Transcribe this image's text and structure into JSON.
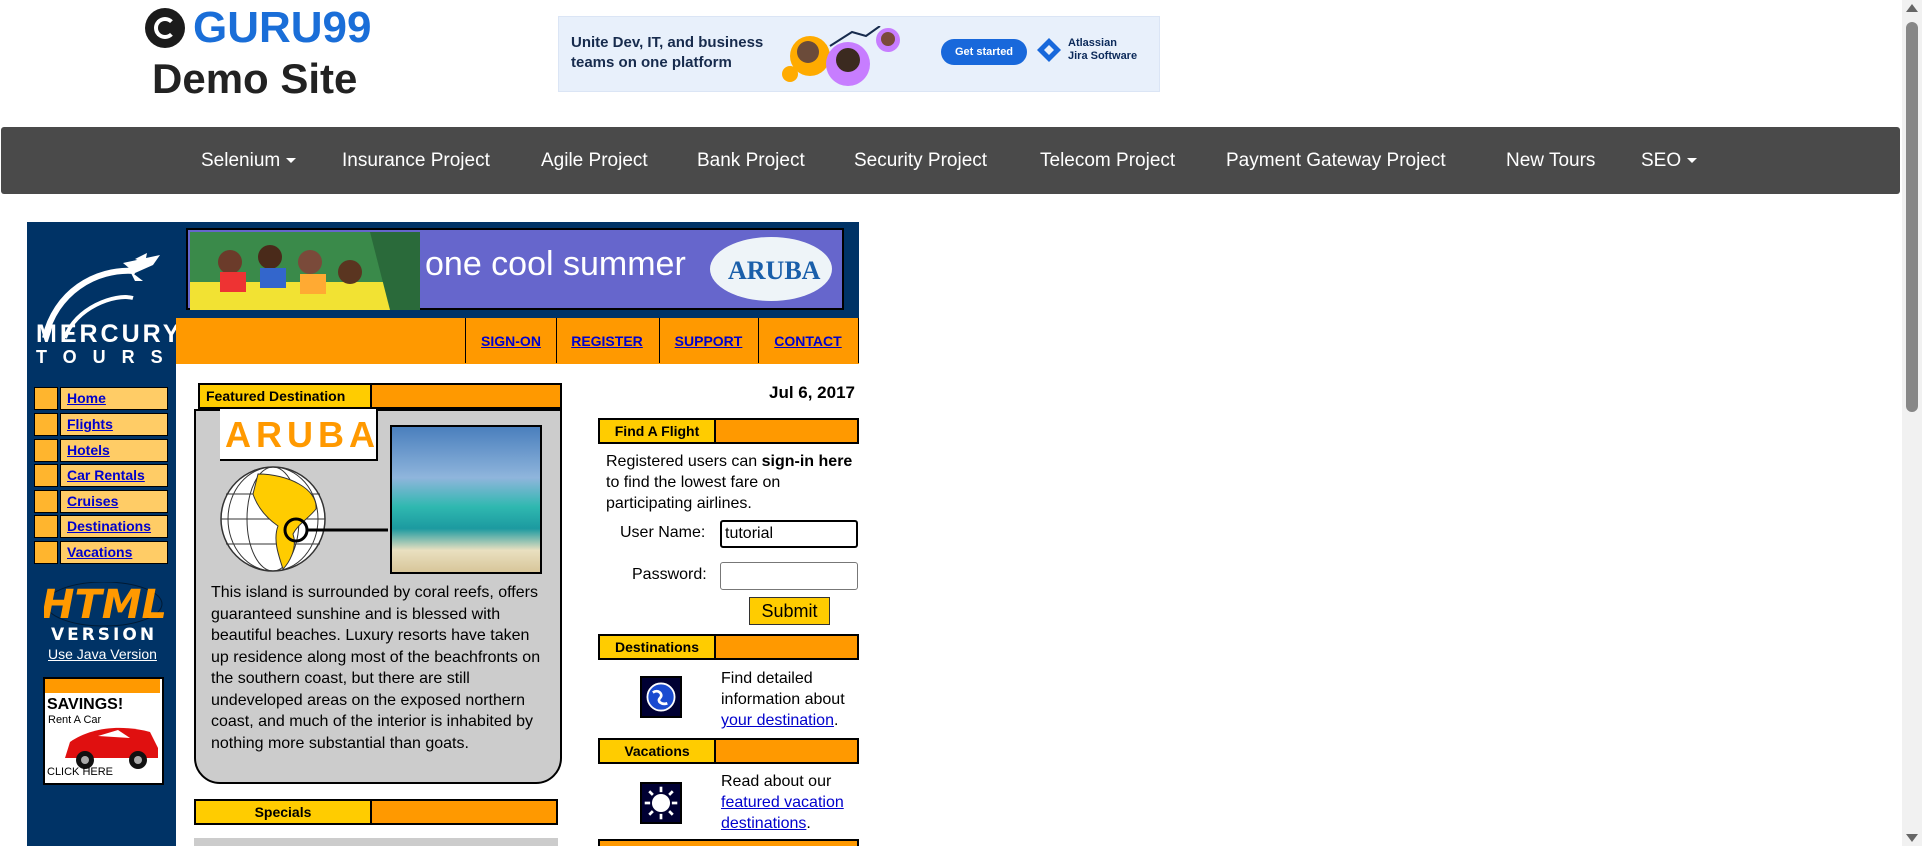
{
  "header": {
    "brand": "GURU99",
    "subtitle": "Demo Site"
  },
  "ad": {
    "text": "Unite Dev, IT, and business teams on one platform",
    "cta": "Get started",
    "brand_line1": "Atlassian",
    "brand_line2": "Jira Software"
  },
  "nav": {
    "items": [
      {
        "label": "Selenium",
        "dropdown": true
      },
      {
        "label": "Insurance Project"
      },
      {
        "label": "Agile Project"
      },
      {
        "label": "Bank Project"
      },
      {
        "label": "Security Project"
      },
      {
        "label": "Telecom Project"
      },
      {
        "label": "Payment Gateway Project"
      },
      {
        "label": "New Tours"
      },
      {
        "label": "SEO",
        "dropdown": true
      }
    ]
  },
  "mercury": {
    "logo_line1": "MERCURY",
    "logo_line2": "TOURS",
    "banner_text": "one cool summer",
    "banner_badge": "ARUBA",
    "top_links": [
      "SIGN-ON",
      "REGISTER",
      "SUPPORT",
      "CONTACT"
    ],
    "side_menu": [
      "Home",
      "Flights",
      "Hotels",
      "Car Rentals",
      "Cruises",
      "Destinations",
      "Vacations"
    ],
    "html_logo_line1": "HTML",
    "html_logo_line2": "VERSION",
    "java_link": "Use Java Version",
    "savings_title": "SAVINGS!",
    "savings_sub": "Rent A Car",
    "savings_click": "CLICK HERE"
  },
  "featured": {
    "heading": "Featured Destination",
    "destination": "ARUBA",
    "description": "This island is surrounded by coral reefs, offers guaranteed sunshine and is blessed with beautiful beaches. Luxury resorts have taken up residence along most of the beachfronts on the southern coast, but there are still undeveloped areas on the exposed northern coast, and much of the interior is inhabited by nothing more substantial than goats.",
    "specials_heading": "Specials"
  },
  "right": {
    "date": "Jul 6, 2017",
    "find_heading": "Find A Flight",
    "find_pre": "Registered users can ",
    "find_bold": "sign-in here",
    "find_post": " to find the lowest fare on participating airlines.",
    "user_label": "User Name:",
    "user_value": "tutorial",
    "pass_label": "Password:",
    "pass_value": "",
    "submit": "Submit",
    "dest_heading": "Destinations",
    "dest_pre": "Find detailed information about ",
    "dest_link": "your destination",
    "dest_post": ".",
    "vac_heading": "Vacations",
    "vac_pre": "Read about our ",
    "vac_link": "featured vacation destinations",
    "vac_post": "."
  },
  "colors": {
    "nav_bg": "#4a4a4a",
    "navy": "#003366",
    "orange": "#ff9900",
    "yellow": "#ffcc00",
    "link": "#0000cc",
    "guru_blue": "#1a6ed8"
  }
}
